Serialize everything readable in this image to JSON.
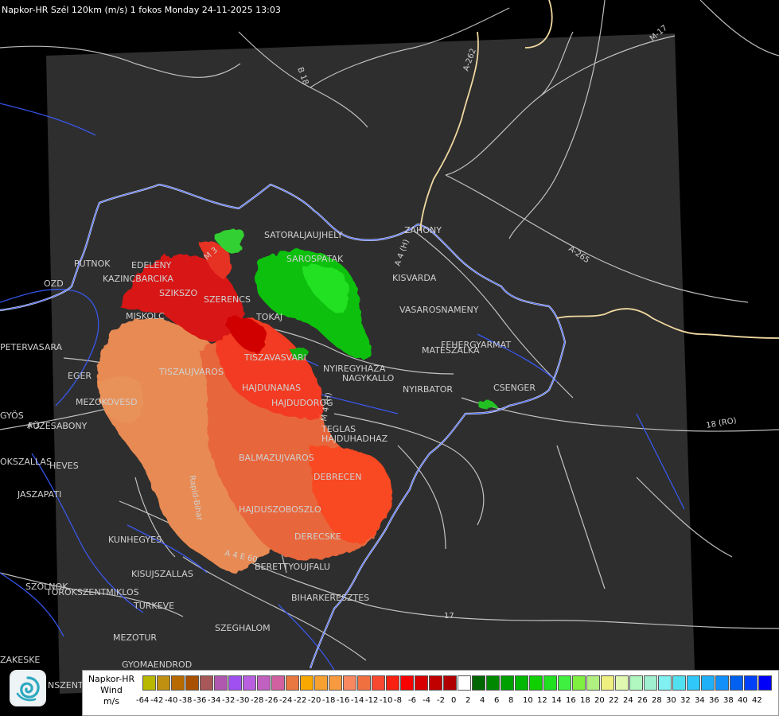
{
  "header": {
    "title": "Napkor-HR Szél 120km (m/s) 1 fokos Monday 24-11-2025 13:03"
  },
  "map": {
    "towns": [
      {
        "id": "satoraljaujhely",
        "name": "SATORALJAUJHELY"
      },
      {
        "id": "sarospatak",
        "name": "SAROSPATAK"
      },
      {
        "id": "zahony",
        "name": "ZAHONY"
      },
      {
        "id": "kisvarda",
        "name": "KISVARDA"
      },
      {
        "id": "vasarosnameny",
        "name": "VASAROSNAMENY"
      },
      {
        "id": "feheryarmat",
        "name": "FEHERGYARMAT"
      },
      {
        "id": "mateszalka",
        "name": "MATESZALKA"
      },
      {
        "id": "csenger",
        "name": "CSENGER"
      },
      {
        "id": "nyirbator",
        "name": "NYIRBATOR"
      },
      {
        "id": "nyiregyhaza",
        "name": "NYIREGYHAZA"
      },
      {
        "id": "nagykallo",
        "name": "NAGYKALLO"
      },
      {
        "id": "putnok",
        "name": "PUTNOK"
      },
      {
        "id": "edeleny",
        "name": "EDELENY"
      },
      {
        "id": "kazincbarcika",
        "name": "KAZINCBARCIKA"
      },
      {
        "id": "ozd",
        "name": "OZD"
      },
      {
        "id": "szikszo",
        "name": "SZIKSZO"
      },
      {
        "id": "szerencs",
        "name": "SZERENCS"
      },
      {
        "id": "tokaj",
        "name": "TOKAJ"
      },
      {
        "id": "miskolc",
        "name": "MISKOLC"
      },
      {
        "id": "petervasara",
        "name": "PETERVASARA"
      },
      {
        "id": "eger",
        "name": "EGER"
      },
      {
        "id": "tiszaujvaros",
        "name": "TISZAUJVAROS"
      },
      {
        "id": "tiszavasvari",
        "name": "TISZAVASVARI"
      },
      {
        "id": "hajdunanas",
        "name": "HAJDUNANAS"
      },
      {
        "id": "hajdudorog",
        "name": "HAJDUDOROG"
      },
      {
        "id": "mezokovesd",
        "name": "MEZOKOVESD"
      },
      {
        "id": "gyongyos",
        "name": "GYÖS"
      },
      {
        "id": "fuzesabony",
        "name": "FÜZESABONY"
      },
      {
        "id": "teglas",
        "name": "TEGLAS"
      },
      {
        "id": "hajduhadhaz",
        "name": "HAJDUHADHAZ"
      },
      {
        "id": "balmazujvaros",
        "name": "BALMAZUJVAROS"
      },
      {
        "id": "heves",
        "name": "HEVES"
      },
      {
        "id": "debrecen",
        "name": "DEBRECEN"
      },
      {
        "id": "jaszapati",
        "name": "JASZAPATI"
      },
      {
        "id": "hajduszoboszlo",
        "name": "HAJDUSZOBOSZLO"
      },
      {
        "id": "derecske",
        "name": "DERECSKE"
      },
      {
        "id": "kunhegyes",
        "name": "KUNHEGYES"
      },
      {
        "id": "berettyoujfalu",
        "name": "BERETTYOUJFALU"
      },
      {
        "id": "kisujszallas",
        "name": "KISUJSZALLAS"
      },
      {
        "id": "szolnok",
        "name": "SZOLNOK"
      },
      {
        "id": "torokszentmiklos",
        "name": "TOROKSZENTMIKLOS"
      },
      {
        "id": "biharkeresztes",
        "name": "BIHARKERESZTES"
      },
      {
        "id": "turkeve",
        "name": "TURKEVE"
      },
      {
        "id": "szeghalom",
        "name": "SZEGHALOM"
      },
      {
        "id": "mezotur",
        "name": "MEZOTUR"
      },
      {
        "id": "kokszallas",
        "name": "OKSZALLAS"
      },
      {
        "id": "kecskemet",
        "name": "ZAKESKE"
      },
      {
        "id": "gyomaendrod",
        "name": "GYOMAENDROD"
      },
      {
        "id": "kunszentmarton",
        "name": "NSZENTM"
      }
    ],
    "roads": [
      {
        "id": "b18",
        "name": "B 18"
      },
      {
        "id": "a262",
        "name": "A-262"
      },
      {
        "id": "m17",
        "name": "M-17"
      },
      {
        "id": "a265",
        "name": "A-265"
      },
      {
        "id": "r18ro",
        "name": "18 (RO)"
      },
      {
        "id": "m3",
        "name": "A 3"
      },
      {
        "id": "e60",
        "name": "A 4 E 60"
      },
      {
        "id": "r17",
        "name": "17"
      },
      {
        "id": "a4",
        "name": "A 4 (H)"
      },
      {
        "id": "m3b",
        "name": "M 3"
      },
      {
        "id": "m4",
        "name": "M 4 (H)"
      },
      {
        "id": "rivhajdu",
        "name": "Rapid-Bihar"
      }
    ]
  },
  "legend": {
    "title_lines": [
      "Napkor-HR",
      "Wind",
      "m/s"
    ],
    "ticks": [
      "-64",
      "-42",
      "-40",
      "-38",
      "-36",
      "-34",
      "-32",
      "-30",
      "-28",
      "-26",
      "-24",
      "-22",
      "-20",
      "-18",
      "-16",
      "-14",
      "-12",
      "-10",
      "-8",
      "-6",
      "-4",
      "-2",
      "0",
      "2",
      "4",
      "6",
      "8",
      "10",
      "12",
      "14",
      "16",
      "18",
      "20",
      "22",
      "24",
      "26",
      "28",
      "30",
      "32",
      "34",
      "36",
      "38",
      "40",
      "42"
    ],
    "colors": [
      "#b8b800",
      "#c09010",
      "#b86a00",
      "#a85000",
      "#a85858",
      "#b058b0",
      "#a050f0",
      "#b860e0",
      "#c060c0",
      "#d060a0",
      "#e87840",
      "#f8a800",
      "#f8a030",
      "#f89a40",
      "#f88860",
      "#f07040",
      "#f84830",
      "#f82010",
      "#f80000",
      "#d80000",
      "#c00000",
      "#b00000",
      "#ffffff",
      "#006600",
      "#008800",
      "#00a000",
      "#00b800",
      "#10d000",
      "#20e020",
      "#40f040",
      "#80f040",
      "#b0f080",
      "#f0f080",
      "#e0f8b0",
      "#b0f8c0",
      "#a0f0d0",
      "#80f0f0",
      "#50e0f0",
      "#30c8f8",
      "#20b0f8",
      "#1090f8",
      "#0060f0",
      "#0040f8",
      "#0000f8"
    ]
  }
}
